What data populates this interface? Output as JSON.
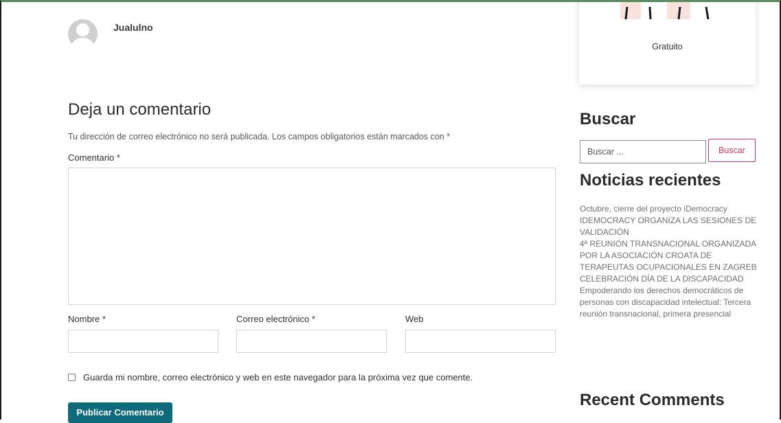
{
  "author": {
    "name": "Jualulno",
    "avatar_icon": "user-avatar-icon"
  },
  "comment_form": {
    "title": "Deja un comentario",
    "notes": "Tu dirección de correo electrónico no será publicada. Los campos obligatorios están marcados con *",
    "comment_label": "Comentario *",
    "comment_value": "",
    "name_label": "Nombre *",
    "name_value": "",
    "email_label": "Correo electrónico *",
    "email_value": "",
    "web_label": "Web",
    "web_value": "",
    "consent_checked": false,
    "consent_label": "Guarda mi nombre, correo electrónico y web en este navegador para la próxima vez que comente.",
    "submit_label": "Publicar Comentario",
    "submit_color": "#0f6a7c"
  },
  "sidebar": {
    "card_label": "Gratuito",
    "search": {
      "title": "Buscar",
      "placeholder": "Buscar ...",
      "button_label": "Buscar",
      "button_color": "#c9385f"
    },
    "recent_news": {
      "title": "Noticias recientes",
      "items": [
        "Octubre, cierre del proyecto iDemocracy",
        "IDEMOCRACY ORGANIZA LAS SESIONES DE VALIDACIÓN",
        "4ª REUNIÓN TRANSNACIONAL ORGANIZADA POR LA ASOCIACIÓN CROATA DE TERAPEUTAS OCUPACIONALES EN ZAGREB",
        "CELEBRACIÓN DÍA DE LA DISCAPACIDAD",
        "Empoderando los derechos democráticos de personas con discapacidad intelectual: Tercera reunión transnacional, primera presencial"
      ]
    },
    "recent_comments": {
      "title": "Recent Comments"
    }
  }
}
